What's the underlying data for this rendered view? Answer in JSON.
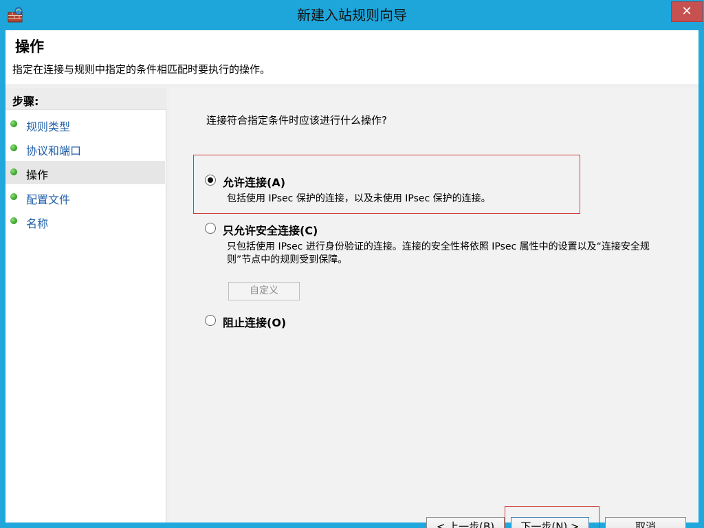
{
  "window": {
    "title": "新建入站规则向导",
    "close_label": "✕"
  },
  "header": {
    "title": "操作",
    "description": "指定在连接与规则中指定的条件相匹配时要执行的操作。"
  },
  "sidebar": {
    "heading": "步骤:",
    "items": [
      {
        "label": "规则类型",
        "active": false
      },
      {
        "label": "协议和端口",
        "active": false
      },
      {
        "label": "操作",
        "active": true
      },
      {
        "label": "配置文件",
        "active": false
      },
      {
        "label": "名称",
        "active": false
      }
    ]
  },
  "main": {
    "question": "连接符合指定条件时应该进行什么操作?",
    "options": [
      {
        "label": "允许连接(A)",
        "description": "包括使用 IPsec 保护的连接，以及未使用 IPsec 保护的连接。",
        "selected": true
      },
      {
        "label": "只允许安全连接(C)",
        "description": "只包括使用 IPsec 进行身份验证的连接。连接的安全性将依照 IPsec 属性中的设置以及“连接安全规则”节点中的规则受到保障。",
        "selected": false
      },
      {
        "label": "阻止连接(O)",
        "description": "",
        "selected": false
      }
    ],
    "customize_label": "自定义"
  },
  "buttons": {
    "back": "< 上一步(B)",
    "next": "下一步(N) >",
    "cancel": "取消"
  },
  "colors": {
    "titlebar": "#1ea6db",
    "highlight": "#d23a3a",
    "step_dot": "#3aa12a",
    "step_link": "#1f5fa8"
  },
  "icons": {
    "app": "firewall-icon",
    "step": "green-dot-icon"
  }
}
